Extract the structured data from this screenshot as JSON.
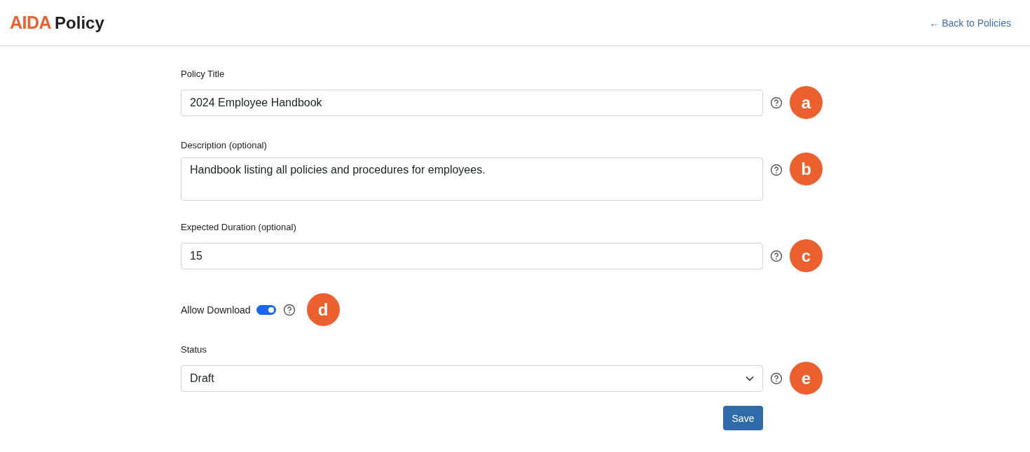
{
  "header": {
    "logo": "AIDA",
    "title": "Policy",
    "back_link": "← Back to Policies"
  },
  "fields": [
    {
      "kind": "text",
      "label": "Policy Title",
      "value": "2024 Employee Handbook",
      "badge": "a"
    },
    {
      "kind": "textarea",
      "label": "Description (optional)",
      "value": "Handbook listing all policies and procedures for employees.",
      "badge": "b"
    },
    {
      "kind": "text",
      "label": "Expected Duration (optional)",
      "value": "15",
      "badge": "c"
    },
    {
      "kind": "toggle",
      "label": "Allow Download",
      "on": true,
      "badge": "d"
    },
    {
      "kind": "select",
      "label": "Status",
      "value": "Draft",
      "badge": "e"
    }
  ],
  "save_button": "Save"
}
